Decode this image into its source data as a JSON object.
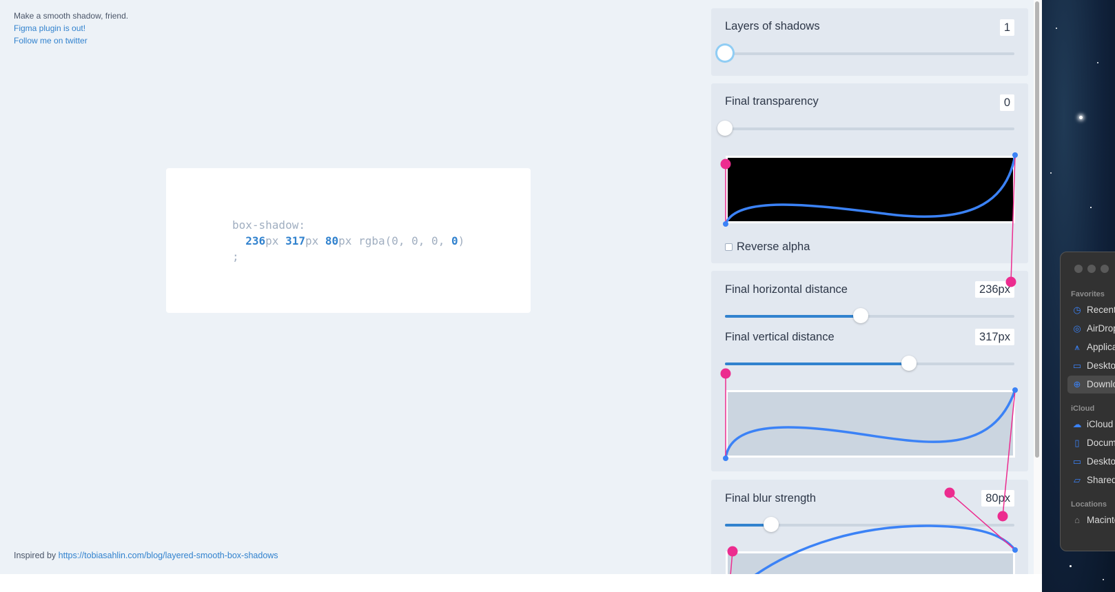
{
  "header": {
    "tagline": "Make a smooth shadow, friend.",
    "figma_link": "Figma plugin is out!",
    "twitter_link": "Follow me on twitter"
  },
  "code": {
    "property": "box-shadow:",
    "x": "236",
    "y": "317",
    "blur": "80",
    "unit": "px",
    "rgba_open": "rgba(",
    "r": "0",
    "g": "0",
    "b": "0",
    "a": "0",
    "rgba_close": ")",
    "terminator": ";"
  },
  "footer": {
    "prefix": "Inspired by",
    "link": "https://tobiasahlin.com/blog/layered-smooth-box-shadows"
  },
  "controls": {
    "layers": {
      "label": "Layers of shadows",
      "value": "1",
      "slider_fraction": 0.0
    },
    "transparency": {
      "label": "Final transparency",
      "value": "0",
      "slider_fraction": 0.0,
      "reverse_label": "Reverse alpha",
      "reverse_checked": false
    },
    "horizontal": {
      "label": "Final horizontal distance",
      "value": "236px",
      "slider_fraction": 0.47
    },
    "vertical": {
      "label": "Final vertical distance",
      "value": "317px",
      "slider_fraction": 0.635
    },
    "blur": {
      "label": "Final blur strength",
      "value": "80px",
      "slider_fraction": 0.16
    }
  },
  "colors": {
    "accent": "#3182ce",
    "curve": "#3b82f6",
    "handle": "#ec2c8f",
    "panel_bg": "#e2e8f0",
    "page_bg": "#edf2f7"
  },
  "finder": {
    "favorites_label": "Favorites",
    "favorites": [
      {
        "label": "Recents",
        "icon": "clock-icon"
      },
      {
        "label": "AirDrop",
        "icon": "airdrop-icon"
      },
      {
        "label": "Applications",
        "icon": "applications-icon"
      },
      {
        "label": "Desktop",
        "icon": "desktop-icon"
      },
      {
        "label": "Downloads",
        "icon": "downloads-icon"
      }
    ],
    "icloud_label": "iCloud",
    "icloud": [
      {
        "label": "iCloud Drive",
        "icon": "cloud-icon"
      },
      {
        "label": "Documents",
        "icon": "document-icon"
      },
      {
        "label": "Desktop",
        "icon": "desktop-icon"
      },
      {
        "label": "Shared",
        "icon": "shared-folder-icon"
      }
    ],
    "locations_label": "Locations",
    "locations": [
      {
        "label": "Macintosh HD",
        "icon": "disk-icon"
      }
    ]
  }
}
